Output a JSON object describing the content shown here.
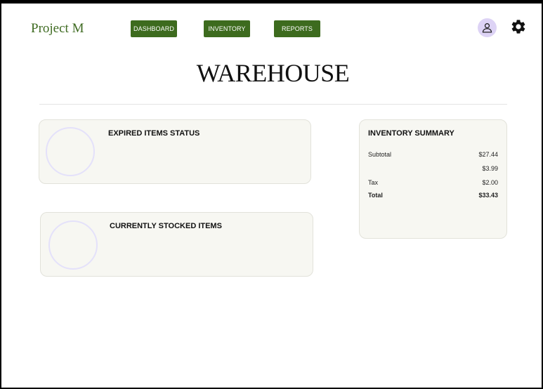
{
  "header": {
    "brand": "Project M",
    "nav": [
      {
        "label": "DASHBOARD"
      },
      {
        "label": "INVENTORY"
      },
      {
        "label": "REPORTS"
      }
    ],
    "icons": {
      "profile": "user-icon",
      "settings": "gear-icon"
    }
  },
  "page": {
    "title": "WAREHOUSE"
  },
  "cards": {
    "expired": {
      "title": "EXPIRED  ITEMS STATUS"
    },
    "stocked": {
      "title": "CURRENTLY STOCKED ITEMS"
    }
  },
  "summary": {
    "title": "INVENTORY SUMMARY",
    "rows": [
      {
        "label": "Subtotal",
        "value": "$27.44"
      },
      {
        "label": "",
        "value": "$3.99"
      },
      {
        "label": "Tax",
        "value": "$2.00"
      },
      {
        "label": "Total",
        "value": "$33.43"
      }
    ]
  },
  "colors": {
    "accent": "#3d6b1e",
    "card_bg": "#f7f7f2",
    "avatar_bg": "#ddd3f5",
    "circle_stroke": "#e4e1fa"
  }
}
